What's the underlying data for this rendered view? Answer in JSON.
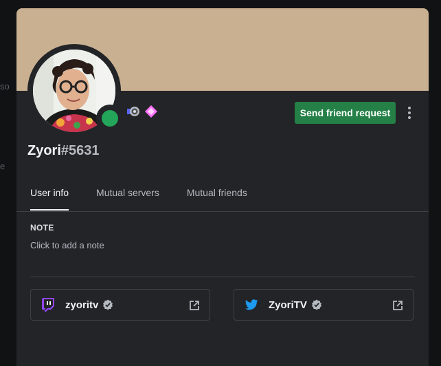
{
  "background": {
    "peek_top": "so",
    "peek_bottom": "e"
  },
  "profile": {
    "username": "Zyori",
    "discriminator": "#5631",
    "status": "online",
    "badges": [
      "hypesquad-balance-icon",
      "nitro-gem-icon"
    ],
    "banner_color": "#c8b091"
  },
  "actions": {
    "send_friend_request": "Send friend request"
  },
  "tabs": [
    {
      "label": "User info",
      "active": true
    },
    {
      "label": "Mutual servers",
      "active": false
    },
    {
      "label": "Mutual friends",
      "active": false
    }
  ],
  "note": {
    "heading": "NOTE",
    "placeholder": "Click to add a note"
  },
  "connections": [
    {
      "service": "twitch-icon",
      "name": "zyoritv",
      "verified": true
    },
    {
      "service": "twitter-icon",
      "name": "ZyoriTV",
      "verified": true
    }
  ],
  "colors": {
    "accent_green": "#248046",
    "status_online": "#23a55a",
    "twitch": "#9146ff",
    "twitter": "#1d9bf0"
  }
}
